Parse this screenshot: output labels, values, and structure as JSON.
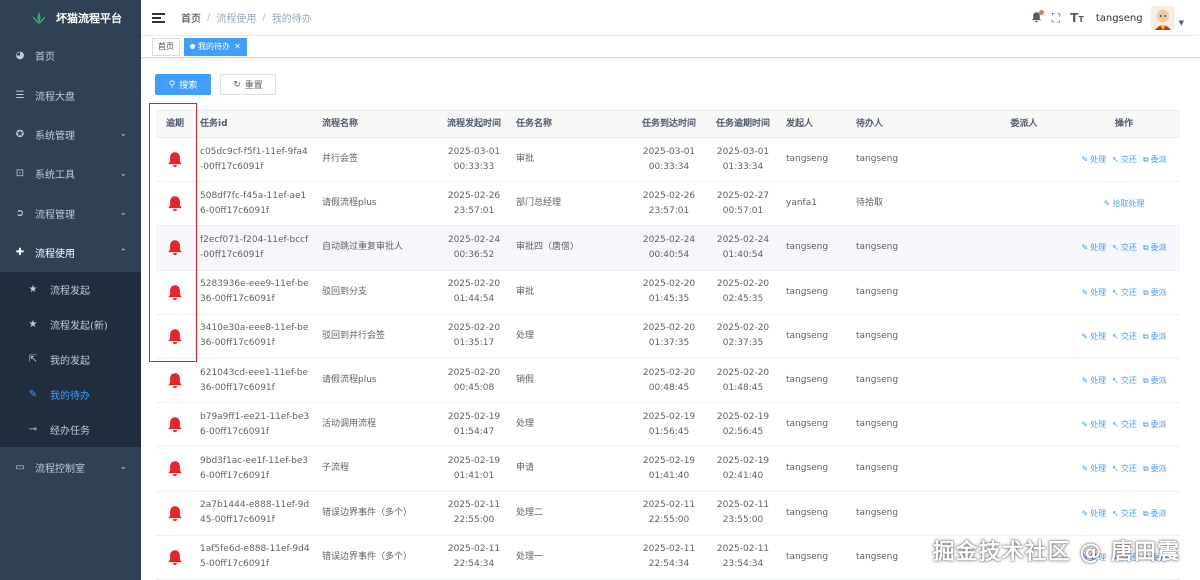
{
  "app": {
    "title": "坏猫流程平台"
  },
  "sidebar": {
    "items": [
      {
        "label": "首页",
        "icon": "dashboard-icon"
      },
      {
        "label": "流程大盘",
        "icon": "list-icon"
      },
      {
        "label": "系统管理",
        "icon": "system-icon",
        "expandable": true
      },
      {
        "label": "系统工具",
        "icon": "tool-icon",
        "expandable": true
      },
      {
        "label": "流程管理",
        "icon": "flow-icon",
        "expandable": true
      },
      {
        "label": "流程使用",
        "icon": "use-icon",
        "expandable": true,
        "expanded": true
      }
    ],
    "sub_items": [
      {
        "label": "流程发起",
        "icon": "star-icon"
      },
      {
        "label": "流程发起(新)",
        "icon": "star-icon"
      },
      {
        "label": "我的发起",
        "icon": "external-icon"
      },
      {
        "label": "我的待办",
        "icon": "edit-icon",
        "active": true
      },
      {
        "label": "经办任务",
        "icon": "key-icon"
      }
    ],
    "last_item": {
      "label": "流程控制室",
      "icon": "monitor-icon"
    }
  },
  "header": {
    "breadcrumb": [
      "首页",
      "流程使用",
      "我的待办"
    ],
    "username": "tangseng"
  },
  "tags": {
    "home": "首页",
    "active": "我的待办"
  },
  "toolbar": {
    "search_label": "搜索",
    "reset_label": "重置"
  },
  "table": {
    "columns": [
      "逾期",
      "任务id",
      "流程名称",
      "流程发起时间",
      "任务名称",
      "任务到达时间",
      "任务逾期时间",
      "发起人",
      "待办人",
      "委派人",
      "操作"
    ],
    "action_labels": {
      "handle": "处理",
      "transfer": "交还",
      "delegate": "委派",
      "claim": "拾取处理"
    },
    "rows": [
      {
        "id": "c05dc9cf-f5f1-11ef-9fa4-00ff17c6091f",
        "process": "并行会签",
        "start": "2025-03-01 00:33:33",
        "task": "审批",
        "arrive": "2025-03-01 00:33:34",
        "overdue": "2025-03-01 01:33:34",
        "starter": "tangseng",
        "assignee": "tangseng",
        "delegator": "",
        "claim": false
      },
      {
        "id": "508df7fc-f45a-11ef-ae16-00ff17c6091f",
        "process": "请假流程plus",
        "start": "2025-02-26 23:57:01",
        "task": "部门总经理",
        "arrive": "2025-02-26 23:57:01",
        "overdue": "2025-02-27 00:57:01",
        "starter": "yanfa1",
        "assignee": "待拾取",
        "delegator": "",
        "claim": true
      },
      {
        "id": "f2ecf071-f204-11ef-bccf-00ff17c6091f",
        "process": "自动跳过重复审批人",
        "start": "2025-02-24 00:36:52",
        "task": "审批四（唐僧）",
        "arrive": "2025-02-24 00:40:54",
        "overdue": "2025-02-24 01:40:54",
        "starter": "tangseng",
        "assignee": "tangseng",
        "delegator": "",
        "claim": false
      },
      {
        "id": "5283936e-eee9-11ef-be36-00ff17c6091f",
        "process": "驳回到分支",
        "start": "2025-02-20 01:44:54",
        "task": "审批",
        "arrive": "2025-02-20 01:45:35",
        "overdue": "2025-02-20 02:45:35",
        "starter": "tangseng",
        "assignee": "tangseng",
        "delegator": "",
        "claim": false
      },
      {
        "id": "3410e30a-eee8-11ef-be36-00ff17c6091f",
        "process": "驳回到并行会签",
        "start": "2025-02-20 01:35:17",
        "task": "处理",
        "arrive": "2025-02-20 01:37:35",
        "overdue": "2025-02-20 02:37:35",
        "starter": "tangseng",
        "assignee": "tangseng",
        "delegator": "",
        "claim": false
      },
      {
        "id": "621043cd-eee1-11ef-be36-00ff17c6091f",
        "process": "请假流程plus",
        "start": "2025-02-20 00:45:08",
        "task": "销假",
        "arrive": "2025-02-20 00:48:45",
        "overdue": "2025-02-20 01:48:45",
        "starter": "tangseng",
        "assignee": "tangseng",
        "delegator": "",
        "claim": false
      },
      {
        "id": "b79a9ff1-ee21-11ef-be36-00ff17c6091f",
        "process": "活动调用流程",
        "start": "2025-02-19 01:54:47",
        "task": "处理",
        "arrive": "2025-02-19 01:56:45",
        "overdue": "2025-02-19 02:56:45",
        "starter": "tangseng",
        "assignee": "tangseng",
        "delegator": "",
        "claim": false
      },
      {
        "id": "9bd3f1ac-ee1f-11ef-be36-00ff17c6091f",
        "process": "子流程",
        "start": "2025-02-19 01:41:01",
        "task": "申请",
        "arrive": "2025-02-19 01:41:40",
        "overdue": "2025-02-19 02:41:40",
        "starter": "tangseng",
        "assignee": "tangseng",
        "delegator": "",
        "claim": false
      },
      {
        "id": "2a7b1444-e888-11ef-9d45-00ff17c6091f",
        "process": "错误边界事件（多个）",
        "start": "2025-02-11 22:55:00",
        "task": "处理二",
        "arrive": "2025-02-11 22:55:00",
        "overdue": "2025-02-11 23:55:00",
        "starter": "tangseng",
        "assignee": "tangseng",
        "delegator": "",
        "claim": false
      },
      {
        "id": "1af5fe6d-e888-11ef-9d45-00ff17c6091f",
        "process": "错误边界事件（多个）",
        "start": "2025-02-11 22:54:34",
        "task": "处理一",
        "arrive": "2025-02-11 22:54:34",
        "overdue": "2025-02-11 23:54:34",
        "starter": "tangseng",
        "assignee": "tangseng",
        "delegator": "",
        "claim": false
      }
    ]
  },
  "watermark": "掘金技术社区 @ 唐田震",
  "colors": {
    "sidebar_bg": "#304156",
    "submenu_bg": "#1f2d3d",
    "accent": "#409eff",
    "overdue_bell": "#e6252a",
    "highlight_box": "#e02020"
  }
}
